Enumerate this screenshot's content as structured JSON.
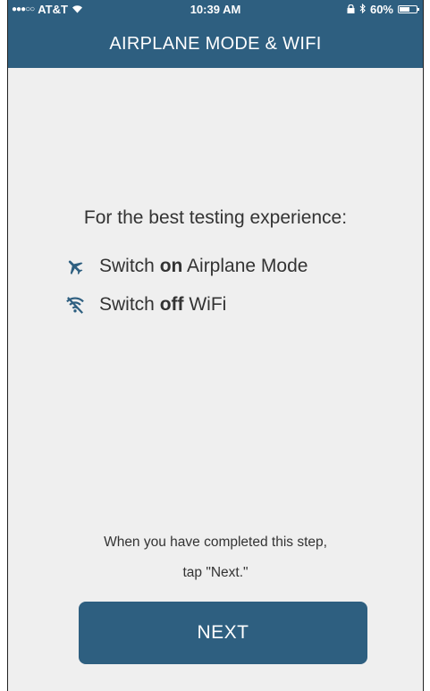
{
  "status_bar": {
    "carrier": "AT&T",
    "time": "10:39 AM",
    "battery": "60%",
    "battery_level": 0.6
  },
  "header": {
    "title": "AIRPLANE MODE & WIFI"
  },
  "main": {
    "headline": "For the best testing experience:",
    "instructions": [
      {
        "icon": "airplane-icon",
        "prefix": "Switch ",
        "emphasis": "on",
        "suffix": " Airplane Mode"
      },
      {
        "icon": "wifi-off-icon",
        "prefix": "Switch ",
        "emphasis": "off",
        "suffix": " WiFi"
      }
    ],
    "footer_line1": "When you have completed this step,",
    "footer_line2": "tap \"Next.\""
  },
  "actions": {
    "next_label": "NEXT"
  },
  "colors": {
    "brand": "#2e5f80",
    "background": "#efefef",
    "text": "#333333"
  }
}
